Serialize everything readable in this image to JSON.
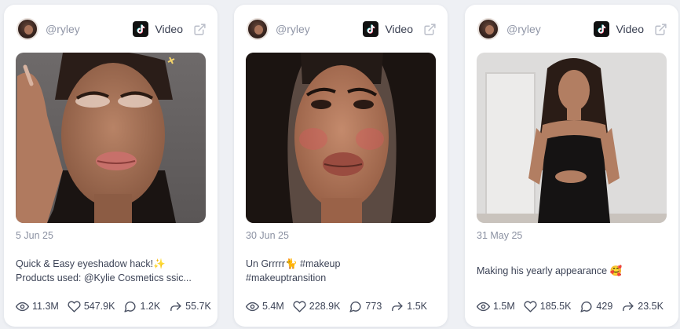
{
  "colors": {
    "background": "#eef0f4",
    "card": "#ffffff",
    "muted_text": "#8b91a2",
    "body_text": "#3c4356"
  },
  "cards": [
    {
      "handle": "@ryley",
      "platform_icon": "tiktok-icon",
      "type_label": "Video",
      "date": "5 Jun 25",
      "caption_lines": [
        "Quick & Easy eyeshadow hack!✨",
        "Products used: @Kylie Cosmetics ssic..."
      ],
      "stats": {
        "views": "11.3M",
        "likes": "547.9K",
        "comments": "1.2K",
        "shares": "55.7K"
      }
    },
    {
      "handle": "@ryley",
      "platform_icon": "tiktok-icon",
      "type_label": "Video",
      "date": "30 Jun 25",
      "caption_lines": [
        "Un Grrrrr🐈 #makeup",
        "#makeuptransition"
      ],
      "stats": {
        "views": "5.4M",
        "likes": "228.9K",
        "comments": "773",
        "shares": "1.5K"
      }
    },
    {
      "handle": "@ryley",
      "platform_icon": "tiktok-icon",
      "type_label": "Video",
      "date": "31 May 25",
      "caption_lines": [
        "Making his yearly appearance 🥰"
      ],
      "stats": {
        "views": "1.5M",
        "likes": "185.5K",
        "comments": "429",
        "shares": "23.5K"
      }
    }
  ]
}
